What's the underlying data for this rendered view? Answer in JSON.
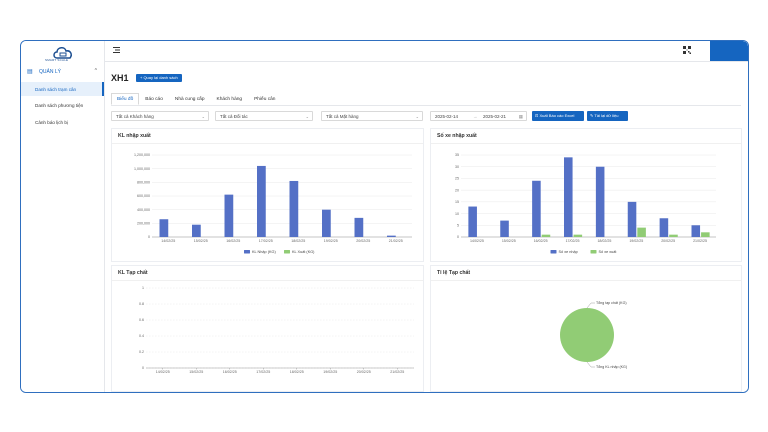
{
  "app": {
    "logo_text": "SMART SCALE"
  },
  "sidebar": {
    "group_label": "QUẢN LÝ",
    "items": [
      {
        "label": "Danh sách trạm cân",
        "active": true
      },
      {
        "label": "Danh sách phương tiện",
        "active": false
      },
      {
        "label": "Cảnh báo lịch bị",
        "active": false
      }
    ]
  },
  "header": {
    "menu_icon": "menu-icon",
    "qr_icon": "qr-code-icon",
    "accent": "#1565c0"
  },
  "page": {
    "title": "XH1",
    "back_button": "+ Quay lại danh sách"
  },
  "tabs": [
    {
      "label": "Biểu đồ",
      "active": true
    },
    {
      "label": "Báo cáo",
      "active": false
    },
    {
      "label": "Nhà cung cấp",
      "active": false
    },
    {
      "label": "Khách hàng",
      "active": false
    },
    {
      "label": "Phiếu cân",
      "active": false
    }
  ],
  "filters": {
    "customer": "Tất cả Khách hàng",
    "partner": "Tất cả Đối tác",
    "product": "Tất cả Mặt hàng",
    "date_from": "2025-02-14",
    "date_to": "2025-02-21",
    "export_button": "Xuất Báo cáo Excel",
    "reload_button": "Tải lại dữ liệu"
  },
  "chart_data": [
    {
      "id": "kl",
      "type": "bar",
      "title": "KL nhập xuất",
      "categories": [
        "14/02/25",
        "15/02/25",
        "16/02/25",
        "17/02/25",
        "18/02/25",
        "19/02/25",
        "20/02/25",
        "21/02/25"
      ],
      "series": [
        {
          "name": "KL Nhập (KG)",
          "color": "#5470c6",
          "values": [
            260000,
            180000,
            620000,
            1040000,
            820000,
            400000,
            280000,
            20000
          ]
        },
        {
          "name": "KL Xuất (KG)",
          "color": "#91cc75",
          "values": [
            0,
            0,
            0,
            0,
            0,
            0,
            0,
            0
          ]
        }
      ],
      "yticks": [
        "0",
        "200,000",
        "400,000",
        "600,000",
        "800,000",
        "1,000,000",
        "1,200,000"
      ],
      "ylim": [
        0,
        1200000
      ],
      "legend": "bottom"
    },
    {
      "id": "xe",
      "type": "bar",
      "title": "Số xe nhập xuất",
      "categories": [
        "14/02/25",
        "15/02/25",
        "16/02/25",
        "17/02/25",
        "18/02/25",
        "19/02/25",
        "20/02/25",
        "21/02/25"
      ],
      "series": [
        {
          "name": "Số xe nhập",
          "color": "#5470c6",
          "values": [
            13,
            7,
            24,
            34,
            30,
            15,
            8,
            5
          ]
        },
        {
          "name": "Số xe xuất",
          "color": "#91cc75",
          "values": [
            0,
            0,
            1,
            1,
            0,
            4,
            1,
            2
          ]
        }
      ],
      "yticks": [
        "0",
        "5",
        "10",
        "15",
        "20",
        "25",
        "30",
        "35"
      ],
      "ylim": [
        0,
        35
      ],
      "legend": "bottom"
    },
    {
      "id": "tap",
      "type": "line",
      "title": "KL Tạp chất",
      "categories": [
        "14/02/25",
        "15/02/25",
        "16/02/25",
        "17/02/25",
        "18/02/25",
        "19/02/25",
        "20/02/25",
        "21/02/25"
      ],
      "series": [],
      "yticks": [
        "0",
        "0.2",
        "0.4",
        "0.6",
        "0.8",
        "1"
      ],
      "ylim": [
        0,
        1
      ]
    },
    {
      "id": "pie",
      "type": "pie",
      "title": "Tỉ lệ Tạp chất",
      "slices": [
        {
          "name": "Tổng tạp chất (KG)",
          "value": 0,
          "color": "#5470c6"
        },
        {
          "name": "Tổng KL nhập (KG)",
          "value": 100,
          "color": "#91cc75"
        }
      ]
    }
  ]
}
